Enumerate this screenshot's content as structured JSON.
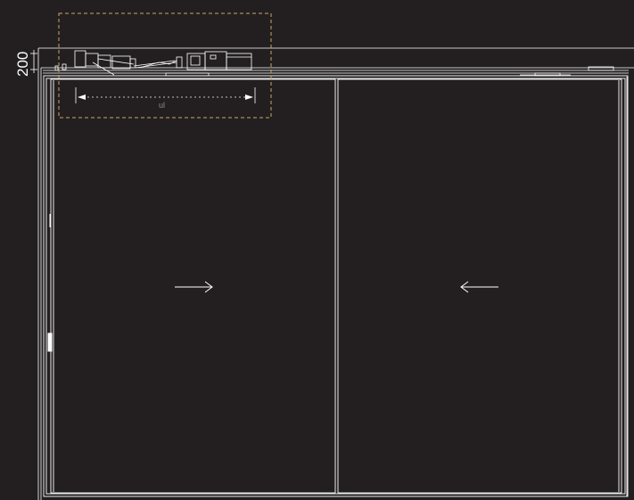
{
  "drawing": {
    "dimension_label": "200",
    "detail_label": "ul",
    "colors": {
      "background": "#231f20",
      "line": "#ffffff",
      "detail_frame": "#c9a66b",
      "dotted_dimension": "#bfbfbf"
    },
    "arrows": {
      "left_panel": "right-arrow-icon",
      "right_panel": "left-arrow-icon"
    }
  }
}
